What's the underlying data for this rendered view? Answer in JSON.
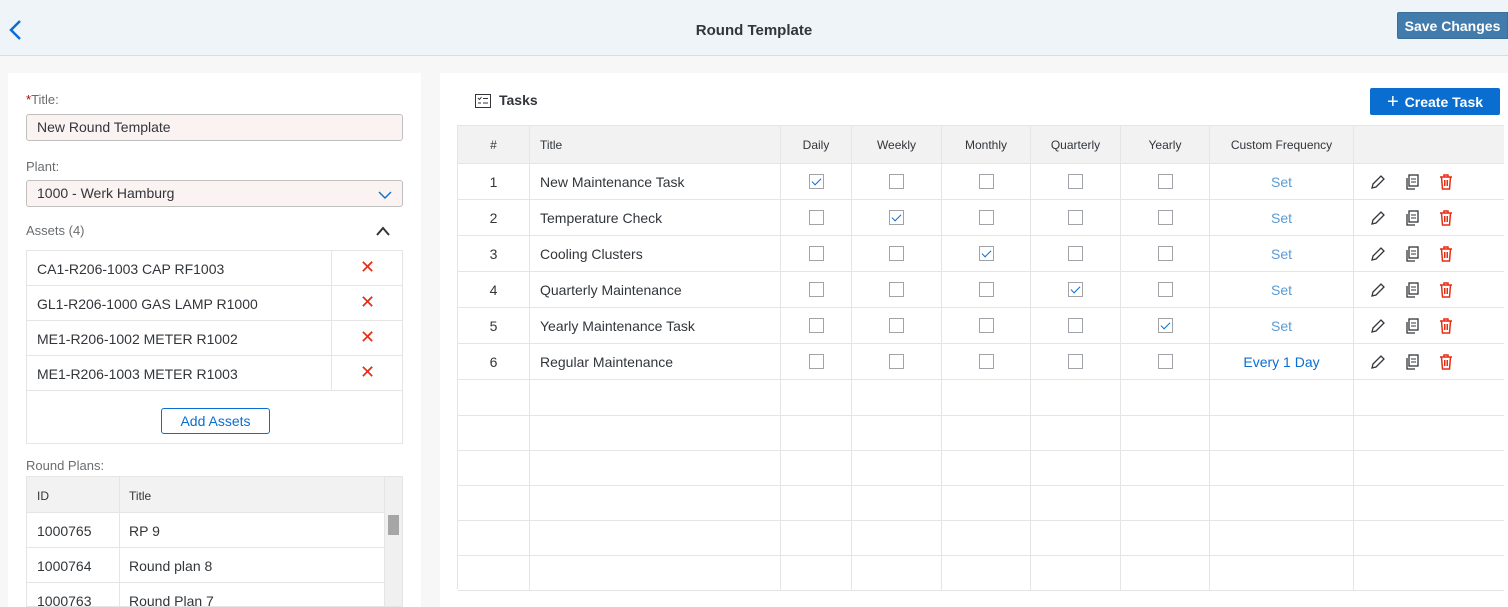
{
  "header": {
    "title": "Round Template",
    "save_label": "Save Changes"
  },
  "form": {
    "title_required_mark": "*",
    "title_label": "Title:",
    "title_value": "New Round Template",
    "plant_label": "Plant:",
    "plant_value": "1000 - Werk Hamburg",
    "assets_label": "Assets (4)",
    "assets": [
      "CA1-R206-1003 CAP RF1003",
      "GL1-R206-1000 GAS LAMP R1000",
      "ME1-R206-1002 METER R1002",
      "ME1-R206-1003 METER R1003"
    ],
    "remove_glyph": "✕",
    "add_assets_label": "Add Assets",
    "round_plans_label": "Round Plans:",
    "round_plans_columns": [
      "ID",
      "Title"
    ],
    "round_plans": [
      {
        "id": "1000765",
        "title": "RP 9"
      },
      {
        "id": "1000764",
        "title": "Round plan 8"
      },
      {
        "id": "1000763",
        "title": "Round Plan 7"
      }
    ]
  },
  "tasks": {
    "title": "Tasks",
    "create_label": "Create Task",
    "create_plus": "+",
    "columns": [
      "#",
      "Title",
      "Daily",
      "Weekly",
      "Monthly",
      "Quarterly",
      "Yearly",
      "Custom Frequency"
    ],
    "rows": [
      {
        "num": "1",
        "title": "New Maintenance Task",
        "checks": [
          true,
          false,
          false,
          false,
          false
        ],
        "custom": "Set"
      },
      {
        "num": "2",
        "title": "Temperature Check",
        "checks": [
          false,
          true,
          false,
          false,
          false
        ],
        "custom": "Set"
      },
      {
        "num": "3",
        "title": "Cooling Clusters",
        "checks": [
          false,
          false,
          true,
          false,
          false
        ],
        "custom": "Set"
      },
      {
        "num": "4",
        "title": "Quarterly Maintenance",
        "checks": [
          false,
          false,
          false,
          true,
          false
        ],
        "custom": "Set"
      },
      {
        "num": "5",
        "title": "Yearly Maintenance Task",
        "checks": [
          false,
          false,
          false,
          false,
          true
        ],
        "custom": "Set"
      },
      {
        "num": "6",
        "title": "Regular Maintenance",
        "checks": [
          false,
          false,
          false,
          false,
          false
        ],
        "custom": "Every 1 Day"
      }
    ],
    "empty_rows": 6
  },
  "icons": {
    "back": "chevron-left-icon",
    "plant_dropdown": "chevron-down-icon",
    "assets_collapse": "chevron-up-icon",
    "remove": "close-icon",
    "tasks": "checklist-icon",
    "edit": "pencil-icon",
    "copy": "copy-icon",
    "delete": "trash-icon"
  },
  "colors": {
    "accent": "#0a6ed1",
    "save": "#427cac",
    "danger": "#e52d14",
    "required": "#bb0000"
  }
}
